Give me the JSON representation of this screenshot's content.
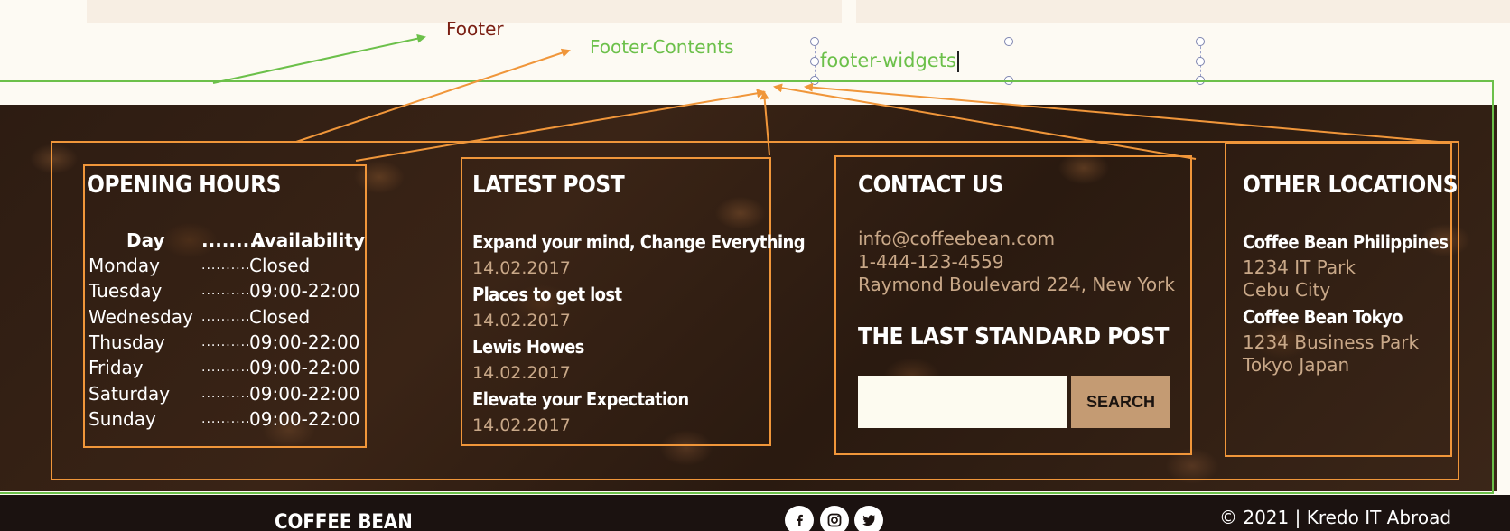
{
  "annotations": {
    "footer_label": "Footer",
    "footer_contents_label": "Footer-Contents",
    "footer_widgets_text": "footer-widgets"
  },
  "opening_hours": {
    "title": "OPENING HOURS",
    "col_day": "Day",
    "col_dots": ".........",
    "col_availability": "Availability",
    "rows": [
      {
        "day": "Monday",
        "dots": "..........",
        "value": "Closed"
      },
      {
        "day": "Tuesday",
        "dots": "..........",
        "value": "09:00-22:00"
      },
      {
        "day": "Wednesday",
        "dots": "..........",
        "value": "Closed"
      },
      {
        "day": "Thusday",
        "dots": "..........",
        "value": "09:00-22:00"
      },
      {
        "day": "Friday",
        "dots": "..........",
        "value": "09:00-22:00"
      },
      {
        "day": "Saturday",
        "dots": "..........",
        "value": "09:00-22:00"
      },
      {
        "day": "Sunday",
        "dots": "..........",
        "value": "09:00-22:00"
      }
    ]
  },
  "latest_post": {
    "title": "LATEST POST",
    "posts": [
      {
        "title": "Expand your mind, Change Everything",
        "date": "14.02.2017"
      },
      {
        "title": "Places to get lost",
        "date": "14.02.2017"
      },
      {
        "title": "Lewis Howes",
        "date": "14.02.2017"
      },
      {
        "title": "Elevate your Expectation",
        "date": "14.02.2017"
      }
    ]
  },
  "contact": {
    "title": "CONTACT US",
    "email": "info@coffeebean.com",
    "phone": "1-444-123-4559",
    "address": "Raymond Boulevard 224, New York",
    "subtitle": "THE LAST STANDARD POST",
    "search_value": "",
    "search_button": "SEARCH"
  },
  "locations": {
    "title": "OTHER LOCATIONS",
    "items": [
      {
        "name": "Coffee Bean Philippines",
        "line1": "1234 IT Park",
        "line2": "Cebu City"
      },
      {
        "name": "Coffee Bean Tokyo",
        "line1": "1234 Business Park",
        "line2": "Tokyo Japan"
      }
    ]
  },
  "bottom": {
    "brand": "COFFEE BEAN",
    "copyright": "© 2021 | Kredo IT Abroad",
    "social_icons": [
      "facebook-icon",
      "instagram-icon",
      "twitter-icon"
    ]
  },
  "colors": {
    "annotation_orange": "#f0963a",
    "annotation_green": "#6cc04a",
    "footer_label": "#7a1e12",
    "accent_tan": "#c49b73",
    "muted_text": "#c9a888"
  }
}
